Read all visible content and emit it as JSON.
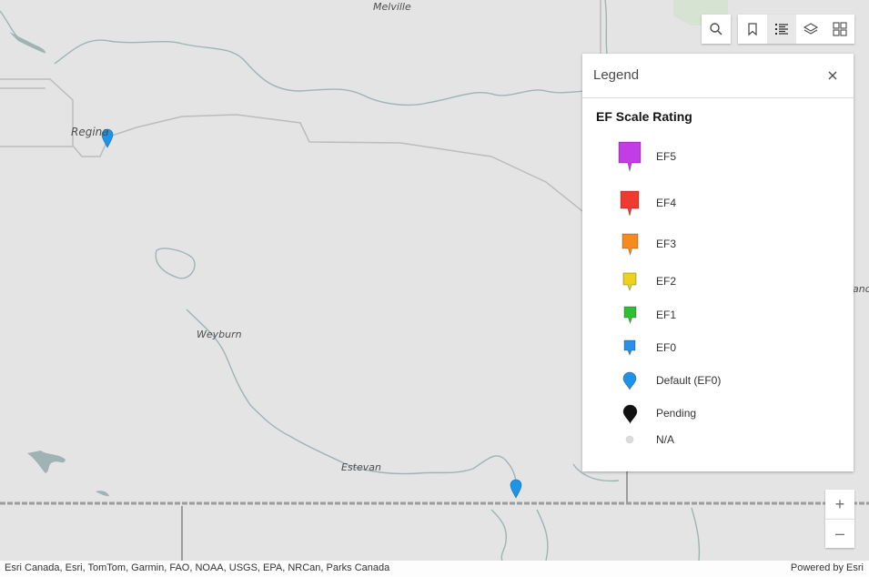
{
  "map": {
    "places": [
      {
        "name": "Melville"
      },
      {
        "name": "Regina"
      },
      {
        "name": "Weyburn"
      },
      {
        "name": "Estevan"
      },
      {
        "name": "and"
      }
    ]
  },
  "toolbar": {
    "search_icon": "search-icon",
    "bookmarks_icon": "bookmark-icon",
    "legend_icon": "legend-list-icon",
    "layers_icon": "layers-icon",
    "basemap_icon": "basemap-gallery-icon",
    "active": "legend"
  },
  "legend": {
    "title": "Legend",
    "layer_title": "EF Scale Rating",
    "items": [
      {
        "label": "EF5",
        "color": "#c33de6"
      },
      {
        "label": "EF4",
        "color": "#f03a30"
      },
      {
        "label": "EF3",
        "color": "#f58b1f"
      },
      {
        "label": "EF2",
        "color": "#ecd21b"
      },
      {
        "label": "EF1",
        "color": "#2fbf32"
      },
      {
        "label": "EF0",
        "color": "#2a8fea"
      },
      {
        "label": "Default (EF0)",
        "color": "#1d94e8"
      },
      {
        "label": "Pending",
        "color": "#111111"
      },
      {
        "label": "N/A",
        "color": "#dcdcdc"
      }
    ]
  },
  "zoom": {
    "in_label": "+",
    "out_label": "–"
  },
  "attribution": {
    "sources": "Esri Canada, Esri, TomTom, Garmin, FAO, NOAA, USGS, EPA, NRCan, Parks Canada",
    "powered_by": "Powered by Esri"
  }
}
